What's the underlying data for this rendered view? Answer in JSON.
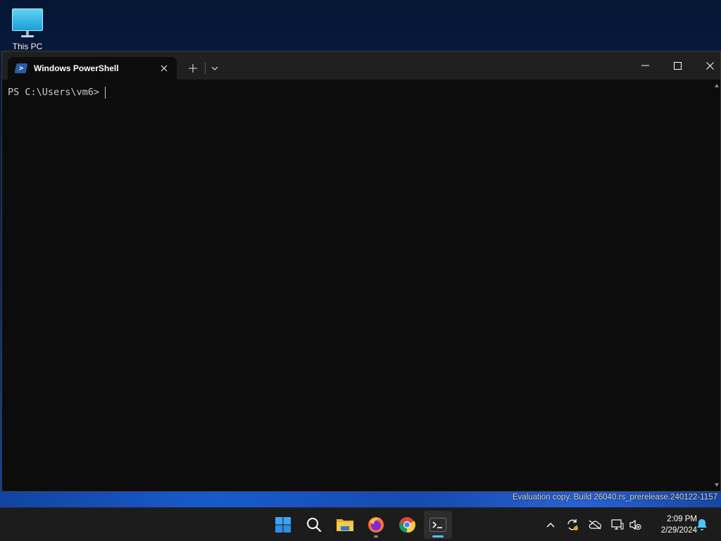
{
  "desktop": {
    "icons": [
      {
        "label": "This PC",
        "icon": "monitor-icon"
      }
    ],
    "watermark": "Evaluation copy. Build 26040.rs_prerelease.240122-1157"
  },
  "window": {
    "tab": {
      "title": "Windows PowerShell",
      "icon": "powershell-icon"
    },
    "terminal": {
      "prompt": "PS C:\\Users\\vm6>"
    },
    "colors": {
      "background": "#0c0c0c",
      "titlebar": "#202020",
      "text": "#cccccc"
    }
  },
  "taskbar": {
    "apps": [
      {
        "name": "Start",
        "icon": "windows-start-icon"
      },
      {
        "name": "Search",
        "icon": "search-icon"
      },
      {
        "name": "File Explorer",
        "icon": "folder-icon"
      },
      {
        "name": "Firefox",
        "icon": "firefox-icon",
        "running": true
      },
      {
        "name": "Chrome",
        "icon": "chrome-icon"
      },
      {
        "name": "Terminal",
        "icon": "terminal-icon",
        "focused": true
      }
    ],
    "tray": [
      "chevron-up-icon",
      "sync-icon",
      "cloud-offline-icon",
      "network-icon",
      "volume-muted-icon",
      "notification-bell-icon"
    ],
    "clock": {
      "time": "2:09 PM",
      "date": "2/29/2024"
    },
    "accent": "#4cc2ff"
  }
}
